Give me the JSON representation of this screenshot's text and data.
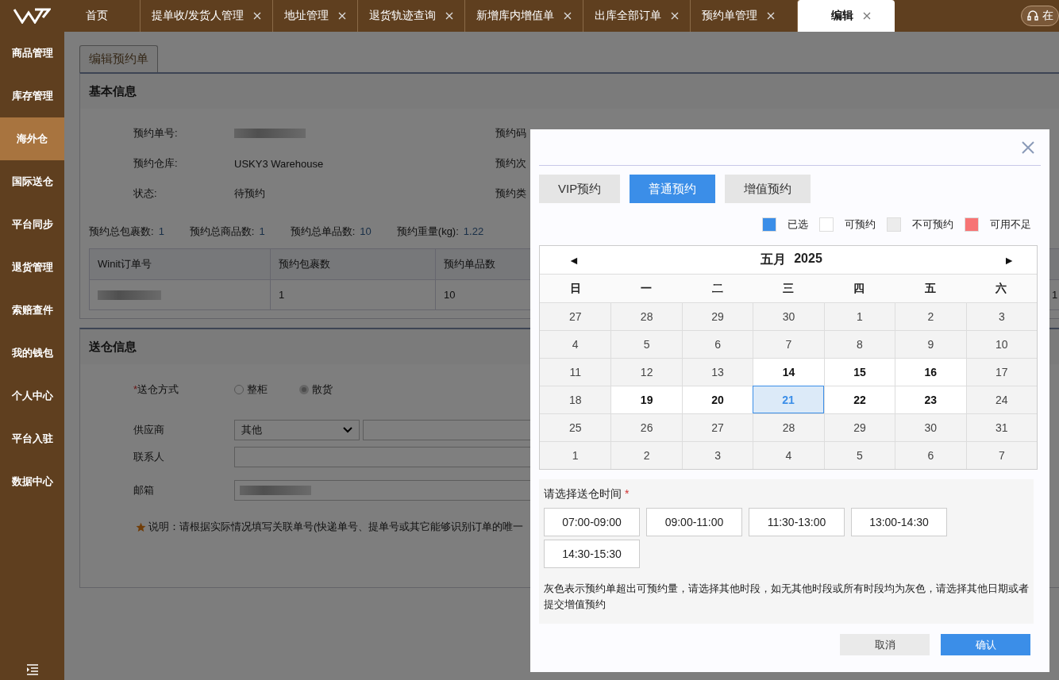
{
  "sidebar": {
    "items": [
      {
        "label": "商品管理",
        "selected": false
      },
      {
        "label": "库存管理",
        "selected": false
      },
      {
        "label": "海外仓",
        "selected": true
      },
      {
        "label": "国际送仓",
        "selected": false
      },
      {
        "label": "平台同步",
        "selected": false
      },
      {
        "label": "退货管理",
        "selected": false
      },
      {
        "label": "索赔查件",
        "selected": false
      },
      {
        "label": "我的钱包",
        "selected": false
      },
      {
        "label": "个人中心",
        "selected": false
      },
      {
        "label": "平台入驻",
        "selected": false
      },
      {
        "label": "数据中心",
        "selected": false
      }
    ]
  },
  "tabs": [
    {
      "label": "首页",
      "closable": false,
      "selected": false
    },
    {
      "label": "提单收/发货人管理",
      "closable": true,
      "selected": false
    },
    {
      "label": "地址管理",
      "closable": true,
      "selected": false
    },
    {
      "label": "退货轨迹查询",
      "closable": true,
      "selected": false
    },
    {
      "label": "新增库内增值单",
      "closable": true,
      "selected": false
    },
    {
      "label": "出库全部订单",
      "closable": true,
      "selected": false
    },
    {
      "label": "预约单管理",
      "closable": true,
      "selected": false
    },
    {
      "label": "编辑",
      "closable": true,
      "selected": true
    }
  ],
  "online_button": {
    "label": "在"
  },
  "page_tab": "编辑预约单",
  "basic_info": {
    "title": "基本信息",
    "fields": [
      {
        "label": "预约单号:",
        "redacted": true
      },
      {
        "label": "预约仓库:",
        "value": "USKY3 Warehouse",
        "redacted": false
      },
      {
        "label": "状态:",
        "value": "待预约",
        "redacted": false
      }
    ],
    "right_labels": [
      "预约码",
      "预约次",
      "预约类"
    ],
    "summary": [
      {
        "label": "预约总包裹数:",
        "value": "1"
      },
      {
        "label": "预约总商品数:",
        "value": "1"
      },
      {
        "label": "预约总单品数:",
        "value": "10"
      },
      {
        "label": "预约重量(kg):",
        "value": "1.22"
      }
    ],
    "table": {
      "columns": [
        "Winit订单号",
        "预约包裹数",
        "预约单品数"
      ],
      "rows": [
        {
          "cells": [
            "",
            "1",
            "10",
            "1"
          ],
          "redacted": true
        }
      ]
    }
  },
  "delivery_info": {
    "title": "送仓信息",
    "method": {
      "label": "送仓方式",
      "required_mark": "*",
      "options": [
        {
          "label": "整柜",
          "selected": false
        },
        {
          "label": "散货",
          "selected": true
        }
      ]
    },
    "supplier": {
      "label": "供应商",
      "value": "其他"
    },
    "contact": {
      "label": "联系人"
    },
    "email": {
      "label": "邮箱",
      "redacted": true
    },
    "note": "说明：请根据实际情况填写关联单号(快递单号、提单号或其它能够识别订单的唯一"
  },
  "modal": {
    "booking_types": [
      {
        "label": "VIP预约",
        "selected": false
      },
      {
        "label": "普通预约",
        "selected": true
      },
      {
        "label": "增值预约",
        "selected": false
      }
    ],
    "legend": [
      {
        "label": "已选",
        "color": "#3b8ee8"
      },
      {
        "label": "可预约",
        "color": "#ffffff"
      },
      {
        "label": "不可预约",
        "color": "#ececec"
      },
      {
        "label": "可用不足",
        "color": "#f77474"
      }
    ],
    "calendar": {
      "prev": "◄",
      "next": "►",
      "month": "五月",
      "year": "2025",
      "weekdays": [
        "日",
        "一",
        "二",
        "三",
        "四",
        "五",
        "六"
      ],
      "days": [
        {
          "label": "27",
          "kind": "unavailable",
          "selected": false
        },
        {
          "label": "28",
          "kind": "unavailable",
          "selected": false
        },
        {
          "label": "29",
          "kind": "unavailable",
          "selected": false
        },
        {
          "label": "30",
          "kind": "unavailable",
          "selected": false
        },
        {
          "label": "1",
          "kind": "unavailable",
          "selected": false
        },
        {
          "label": "2",
          "kind": "unavailable",
          "selected": false
        },
        {
          "label": "3",
          "kind": "unavailable",
          "selected": false
        },
        {
          "label": "4",
          "kind": "unavailable",
          "selected": false
        },
        {
          "label": "5",
          "kind": "unavailable",
          "selected": false
        },
        {
          "label": "6",
          "kind": "unavailable",
          "selected": false
        },
        {
          "label": "7",
          "kind": "unavailable",
          "selected": false
        },
        {
          "label": "8",
          "kind": "unavailable",
          "selected": false
        },
        {
          "label": "9",
          "kind": "unavailable",
          "selected": false
        },
        {
          "label": "10",
          "kind": "unavailable",
          "selected": false
        },
        {
          "label": "11",
          "kind": "unavailable",
          "selected": false
        },
        {
          "label": "12",
          "kind": "unavailable",
          "selected": false
        },
        {
          "label": "13",
          "kind": "unavailable",
          "selected": false
        },
        {
          "label": "14",
          "kind": "available",
          "selected": false
        },
        {
          "label": "15",
          "kind": "available",
          "selected": false
        },
        {
          "label": "16",
          "kind": "available",
          "selected": false
        },
        {
          "label": "17",
          "kind": "unavailable",
          "selected": false
        },
        {
          "label": "18",
          "kind": "unavailable",
          "selected": false
        },
        {
          "label": "19",
          "kind": "available",
          "selected": false
        },
        {
          "label": "20",
          "kind": "available",
          "selected": false
        },
        {
          "label": "21",
          "kind": "available",
          "selected": true
        },
        {
          "label": "22",
          "kind": "available",
          "selected": false
        },
        {
          "label": "23",
          "kind": "available",
          "selected": false
        },
        {
          "label": "24",
          "kind": "unavailable",
          "selected": false
        },
        {
          "label": "25",
          "kind": "unavailable",
          "selected": false
        },
        {
          "label": "26",
          "kind": "unavailable",
          "selected": false
        },
        {
          "label": "27",
          "kind": "unavailable",
          "selected": false
        },
        {
          "label": "28",
          "kind": "unavailable",
          "selected": false
        },
        {
          "label": "29",
          "kind": "unavailable",
          "selected": false
        },
        {
          "label": "30",
          "kind": "unavailable",
          "selected": false
        },
        {
          "label": "31",
          "kind": "unavailable",
          "selected": false
        },
        {
          "label": "1",
          "kind": "unavailable",
          "selected": false
        },
        {
          "label": "2",
          "kind": "unavailable",
          "selected": false
        },
        {
          "label": "3",
          "kind": "unavailable",
          "selected": false
        },
        {
          "label": "4",
          "kind": "unavailable",
          "selected": false
        },
        {
          "label": "5",
          "kind": "unavailable",
          "selected": false
        },
        {
          "label": "6",
          "kind": "unavailable",
          "selected": false
        },
        {
          "label": "7",
          "kind": "unavailable",
          "selected": false
        }
      ]
    },
    "time": {
      "label": "请选择送仓时间",
      "required_mark": "*",
      "slots": [
        {
          "label": "07:00-09:00",
          "selected": false
        },
        {
          "label": "09:00-11:00",
          "selected": false
        },
        {
          "label": "11:30-13:00",
          "selected": false
        },
        {
          "label": "13:00-14:30",
          "selected": false
        },
        {
          "label": "14:30-15:30",
          "selected": false
        }
      ],
      "note": "灰色表示预约单超出可预约量，请选择其他时段，如无其他时段或所有时段均为灰色，请选择其他日期或者提交增值预约"
    },
    "buttons": [
      {
        "label": "取消",
        "kind": "secondary"
      },
      {
        "label": "确认",
        "kind": "primary"
      }
    ]
  }
}
